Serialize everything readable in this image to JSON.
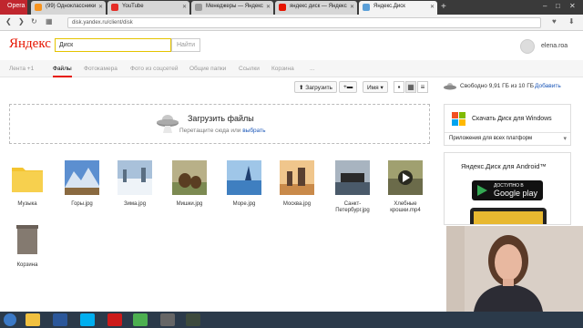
{
  "browser": {
    "menu_label": "Opera",
    "tabs": [
      {
        "label": "(99) Одноклассники",
        "active": false,
        "favicon_color": "#f7931e"
      },
      {
        "label": "YouTube",
        "active": false,
        "favicon_color": "#e52d27"
      },
      {
        "label": "Менеджеры — Яндекс",
        "active": false,
        "favicon_color": "#999999"
      },
      {
        "label": "яндекс диск — Яндекс",
        "active": false,
        "favicon_color": "#e61400"
      },
      {
        "label": "Яндекс.Диск",
        "active": true,
        "favicon_color": "#5a9fd8"
      }
    ],
    "url": "disk.yandex.ru/client/disk"
  },
  "header": {
    "logo": "Яндекс",
    "search_value": "Диск",
    "search_button": "Найти",
    "username": "elena.roa"
  },
  "nav": {
    "tabs": [
      {
        "label": "Лента +1",
        "active": false
      },
      {
        "label": "Файлы",
        "active": true
      },
      {
        "label": "Фотокамера",
        "active": false
      },
      {
        "label": "Фото из соцсетей",
        "active": false
      },
      {
        "label": "Общие папки",
        "active": false
      },
      {
        "label": "Ссылки",
        "active": false
      },
      {
        "label": "Корзина",
        "active": false
      },
      {
        "label": "...",
        "active": false
      }
    ]
  },
  "toolbar": {
    "upload_label": "Загрузить",
    "sort_label": "Имя"
  },
  "upload_area": {
    "title": "Загрузить файлы",
    "subtitle": "Перетащите сюда или",
    "link": "выбрать"
  },
  "files": [
    {
      "name": "Музыка",
      "kind": "folder"
    },
    {
      "name": "Горы.jpg",
      "kind": "image",
      "colors": [
        "#5c8fd0",
        "#d8e4f2",
        "#8a6a40"
      ]
    },
    {
      "name": "Зима.jpg",
      "kind": "image",
      "colors": [
        "#a9c1da",
        "#eef3f8",
        "#5a6e82"
      ]
    },
    {
      "name": "Мишки.jpg",
      "kind": "image",
      "colors": [
        "#7c8a52",
        "#5a3e22",
        "#b8b088"
      ]
    },
    {
      "name": "Море.jpg",
      "kind": "image",
      "colors": [
        "#3f7fc0",
        "#9fc6e8",
        "#1f3f70"
      ]
    },
    {
      "name": "Москва.jpg",
      "kind": "image",
      "colors": [
        "#c98a4a",
        "#f0c68c",
        "#5a4030"
      ]
    },
    {
      "name": "Санкт-Петербург.jpg",
      "kind": "image",
      "colors": [
        "#4a5a6a",
        "#a8b4c0",
        "#2a2a2a"
      ]
    },
    {
      "name": "Хлебные крошки.mp4",
      "kind": "video",
      "colors": [
        "#6b6b4a",
        "#a0a070",
        "#2a2a20"
      ]
    },
    {
      "name": "Корзина",
      "kind": "trash"
    }
  ],
  "sidebar": {
    "space_text": "Свободно 9,91 ГБ из 10 ГБ",
    "buy_link": "Добавить",
    "windows_title": "Скачать Диск для Windows",
    "all_platforms": "Приложения для всех платформ",
    "android_title": "Яндекс.Диск для Android™",
    "gplay_small": "ДОСТУПНО В",
    "gplay_big": "Google play"
  },
  "colors": {
    "accent": "#e61400",
    "link": "#1a56b8",
    "browser_dark": "#3a3a3a",
    "opera_red": "#c0262e"
  }
}
